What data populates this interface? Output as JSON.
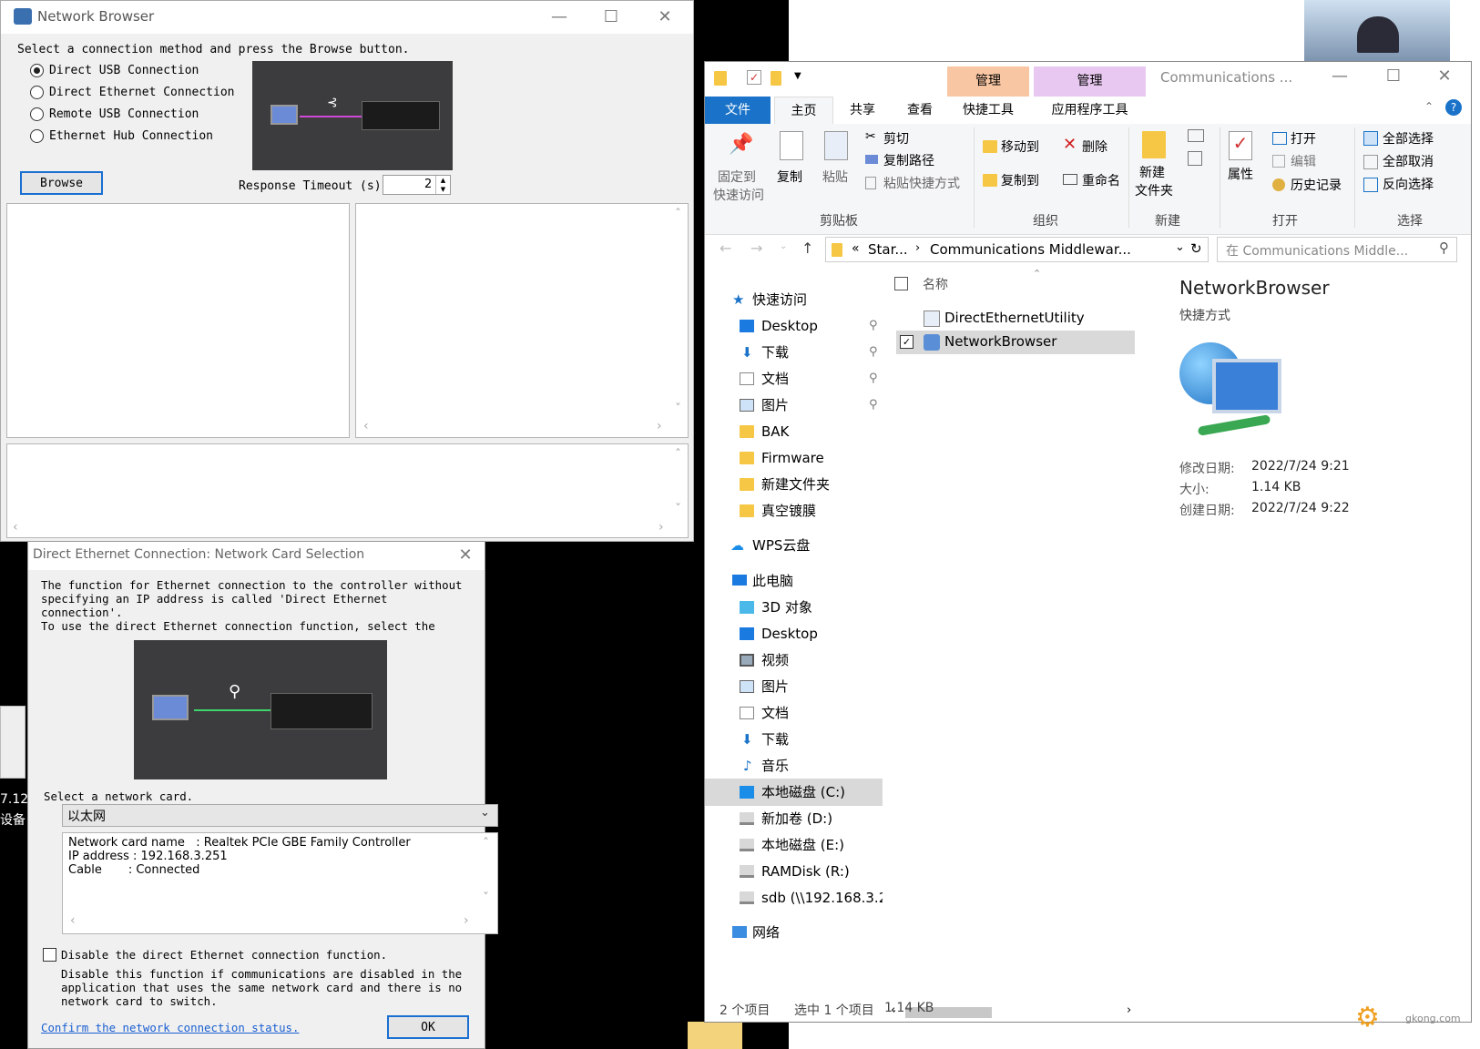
{
  "network_browser": {
    "title": "Network Browser",
    "instruction": "Select a connection method and press the Browse button.",
    "options": [
      "Direct USB Connection",
      "Direct Ethernet Connection",
      "Remote USB Connection",
      "Ethernet Hub Connection"
    ],
    "selected_index": 0,
    "browse_label": "Browse",
    "timeout_label": "Response Timeout (s)",
    "timeout_value": "2"
  },
  "netcard_dialog": {
    "title": "Direct Ethernet Connection: Network Card Selection",
    "desc_line1": "The function for Ethernet connection to the controller without",
    "desc_line2": "specifying an IP address is called 'Direct Ethernet",
    "desc_line3": "connection'.",
    "desc_line4": "To use the direct Ethernet connection function, select the",
    "select_label": "Select a network card.",
    "selected_card": "以太网",
    "info_line1": "Network card name   : Realtek PCIe GBE Family Controller",
    "info_line2": "IP address : 192.168.3.251",
    "info_line3": "Cable       : Connected",
    "disable_label": "Disable the direct Ethernet connection function.",
    "note_line1": "Disable this function if communications are disabled in the",
    "note_line2": "application that uses the same network card and there is no",
    "note_line3": "network card to switch.",
    "confirm_link": "Confirm the network connection status.",
    "ok_label": "OK"
  },
  "explorer": {
    "title": "Communications ...",
    "ctx_tab1": "管理",
    "ctx_tab2": "管理",
    "tabs": {
      "file": "文件",
      "home": "主页",
      "share": "共享",
      "view": "查看",
      "shortcut_tools": "快捷工具",
      "app_tools": "应用程序工具"
    },
    "ribbon": {
      "pin": "固定到",
      "pin2": "快速访问",
      "copy": "复制",
      "paste": "粘贴",
      "cut": "剪切",
      "copy_path": "复制路径",
      "paste_shortcut": "粘贴快捷方式",
      "move_to": "移动到",
      "copy_to": "复制到",
      "delete": "删除",
      "rename": "重命名",
      "new_folder": "新建",
      "new_folder2": "文件夹",
      "properties": "属性",
      "open": "打开",
      "edit": "编辑",
      "history": "历史记录",
      "select_all": "全部选择",
      "select_none": "全部取消",
      "invert": "反向选择",
      "grp_clipboard": "剪贴板",
      "grp_organize": "组织",
      "grp_new": "新建",
      "grp_open": "打开",
      "grp_select": "选择"
    },
    "address": {
      "part1": "Star...",
      "part2": "Communications Middlewar..."
    },
    "search_placeholder": "在 Communications Middle...",
    "nav": {
      "quick": "快速访问",
      "desktop": "Desktop",
      "downloads": "下载",
      "docs": "文档",
      "pics": "图片",
      "bak": "BAK",
      "firmware": "Firmware",
      "newfolder": "新建文件夹",
      "vacuum": "真空镀膜",
      "wps": "WPS云盘",
      "pc": "此电脑",
      "obj3d": "3D 对象",
      "desktop2": "Desktop",
      "videos": "视频",
      "pics2": "图片",
      "docs2": "文档",
      "downloads2": "下载",
      "music": "音乐",
      "c": "本地磁盘 (C:)",
      "d": "新加卷 (D:)",
      "e": "本地磁盘 (E:)",
      "r": "RAMDisk (R:)",
      "sdb": "sdb (\\\\192.168.3.2",
      "network": "网络"
    },
    "col_name": "名称",
    "files": [
      "DirectEthernetUtility",
      "NetworkBrowser"
    ],
    "details": {
      "name": "NetworkBrowser",
      "type": "快捷方式",
      "modified_label": "修改日期:",
      "modified": "2022/7/24 9:21",
      "size_label": "大小:",
      "size": "1.14 KB",
      "created_label": "创建日期:",
      "created": "2022/7/24 9:22"
    },
    "status": {
      "count": "2 个项目",
      "selected": "选中 1 个项目",
      "size": "1.14 KB"
    }
  },
  "desktop": {
    "frag1": "7.12",
    "frag2": "设备",
    "watermark": "gkong.com"
  }
}
